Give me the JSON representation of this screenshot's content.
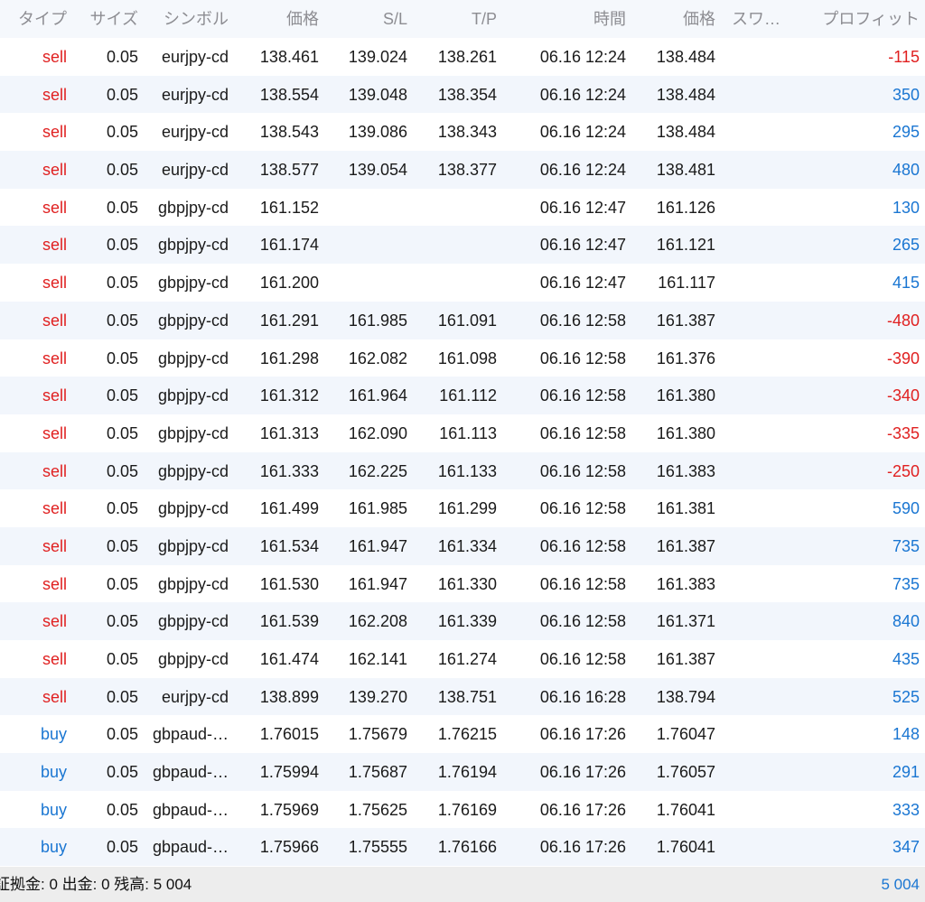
{
  "colors": {
    "sell": "#e02020",
    "buy": "#1a76d2",
    "profit_positive": "#1a76d2",
    "profit_negative": "#e02020",
    "header_bg": "#f5f8fc",
    "alt_row_bg": "#f2f6fc",
    "footer_bg": "#ededed"
  },
  "header": {
    "type": "タイプ",
    "size": "サイズ",
    "symbol": "シンボル",
    "open_price": "価格",
    "sl": "S/L",
    "tp": "T/P",
    "time": "時間",
    "price": "価格",
    "swap": "スワ…",
    "profit": "プロフィット"
  },
  "rows": [
    {
      "type": "sell",
      "size": "0.05",
      "symbol": "eurjpy-cd",
      "open": "138.461",
      "sl": "139.024",
      "tp": "138.261",
      "time": "06.16 12:24",
      "price": "138.484",
      "profit": "-115"
    },
    {
      "type": "sell",
      "size": "0.05",
      "symbol": "eurjpy-cd",
      "open": "138.554",
      "sl": "139.048",
      "tp": "138.354",
      "time": "06.16 12:24",
      "price": "138.484",
      "profit": "350"
    },
    {
      "type": "sell",
      "size": "0.05",
      "symbol": "eurjpy-cd",
      "open": "138.543",
      "sl": "139.086",
      "tp": "138.343",
      "time": "06.16 12:24",
      "price": "138.484",
      "profit": "295"
    },
    {
      "type": "sell",
      "size": "0.05",
      "symbol": "eurjpy-cd",
      "open": "138.577",
      "sl": "139.054",
      "tp": "138.377",
      "time": "06.16 12:24",
      "price": "138.481",
      "profit": "480"
    },
    {
      "type": "sell",
      "size": "0.05",
      "symbol": "gbpjpy-cd",
      "open": "161.152",
      "sl": "",
      "tp": "",
      "time": "06.16 12:47",
      "price": "161.126",
      "profit": "130"
    },
    {
      "type": "sell",
      "size": "0.05",
      "symbol": "gbpjpy-cd",
      "open": "161.174",
      "sl": "",
      "tp": "",
      "time": "06.16 12:47",
      "price": "161.121",
      "profit": "265"
    },
    {
      "type": "sell",
      "size": "0.05",
      "symbol": "gbpjpy-cd",
      "open": "161.200",
      "sl": "",
      "tp": "",
      "time": "06.16 12:47",
      "price": "161.117",
      "profit": "415"
    },
    {
      "type": "sell",
      "size": "0.05",
      "symbol": "gbpjpy-cd",
      "open": "161.291",
      "sl": "161.985",
      "tp": "161.091",
      "time": "06.16 12:58",
      "price": "161.387",
      "profit": "-480"
    },
    {
      "type": "sell",
      "size": "0.05",
      "symbol": "gbpjpy-cd",
      "open": "161.298",
      "sl": "162.082",
      "tp": "161.098",
      "time": "06.16 12:58",
      "price": "161.376",
      "profit": "-390"
    },
    {
      "type": "sell",
      "size": "0.05",
      "symbol": "gbpjpy-cd",
      "open": "161.312",
      "sl": "161.964",
      "tp": "161.112",
      "time": "06.16 12:58",
      "price": "161.380",
      "profit": "-340"
    },
    {
      "type": "sell",
      "size": "0.05",
      "symbol": "gbpjpy-cd",
      "open": "161.313",
      "sl": "162.090",
      "tp": "161.113",
      "time": "06.16 12:58",
      "price": "161.380",
      "profit": "-335"
    },
    {
      "type": "sell",
      "size": "0.05",
      "symbol": "gbpjpy-cd",
      "open": "161.333",
      "sl": "162.225",
      "tp": "161.133",
      "time": "06.16 12:58",
      "price": "161.383",
      "profit": "-250"
    },
    {
      "type": "sell",
      "size": "0.05",
      "symbol": "gbpjpy-cd",
      "open": "161.499",
      "sl": "161.985",
      "tp": "161.299",
      "time": "06.16 12:58",
      "price": "161.381",
      "profit": "590"
    },
    {
      "type": "sell",
      "size": "0.05",
      "symbol": "gbpjpy-cd",
      "open": "161.534",
      "sl": "161.947",
      "tp": "161.334",
      "time": "06.16 12:58",
      "price": "161.387",
      "profit": "735"
    },
    {
      "type": "sell",
      "size": "0.05",
      "symbol": "gbpjpy-cd",
      "open": "161.530",
      "sl": "161.947",
      "tp": "161.330",
      "time": "06.16 12:58",
      "price": "161.383",
      "profit": "735"
    },
    {
      "type": "sell",
      "size": "0.05",
      "symbol": "gbpjpy-cd",
      "open": "161.539",
      "sl": "162.208",
      "tp": "161.339",
      "time": "06.16 12:58",
      "price": "161.371",
      "profit": "840"
    },
    {
      "type": "sell",
      "size": "0.05",
      "symbol": "gbpjpy-cd",
      "open": "161.474",
      "sl": "162.141",
      "tp": "161.274",
      "time": "06.16 12:58",
      "price": "161.387",
      "profit": "435"
    },
    {
      "type": "sell",
      "size": "0.05",
      "symbol": "eurjpy-cd",
      "open": "138.899",
      "sl": "139.270",
      "tp": "138.751",
      "time": "06.16 16:28",
      "price": "138.794",
      "profit": "525"
    },
    {
      "type": "buy",
      "size": "0.05",
      "symbol": "gbpaud-…",
      "open": "1.76015",
      "sl": "1.75679",
      "tp": "1.76215",
      "time": "06.16 17:26",
      "price": "1.76047",
      "profit": "148"
    },
    {
      "type": "buy",
      "size": "0.05",
      "symbol": "gbpaud-…",
      "open": "1.75994",
      "sl": "1.75687",
      "tp": "1.76194",
      "time": "06.16 17:26",
      "price": "1.76057",
      "profit": "291"
    },
    {
      "type": "buy",
      "size": "0.05",
      "symbol": "gbpaud-…",
      "open": "1.75969",
      "sl": "1.75625",
      "tp": "1.76169",
      "time": "06.16 17:26",
      "price": "1.76041",
      "profit": "333"
    },
    {
      "type": "buy",
      "size": "0.05",
      "symbol": "gbpaud-…",
      "open": "1.75966",
      "sl": "1.75555",
      "tp": "1.76166",
      "time": "06.16 17:26",
      "price": "1.76041",
      "profit": "347"
    }
  ],
  "footer": {
    "summary": "証拠金: 0 出金: 0 残高: 5 004",
    "total": "5 004"
  }
}
